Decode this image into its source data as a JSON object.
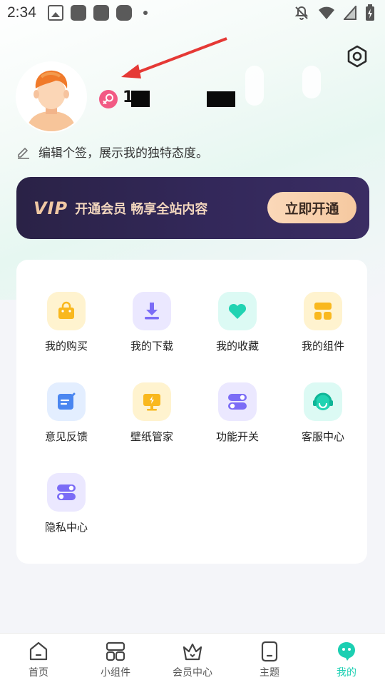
{
  "status_bar": {
    "time": "2:34"
  },
  "profile": {
    "username": "1",
    "bio": "编辑个签，展示我的独特态度。"
  },
  "vip": {
    "logo": "VIP",
    "text": "开通会员 畅享全站内容",
    "button": "立即开通",
    "accent": "#f6c9a0"
  },
  "grid": [
    {
      "label": "我的购买",
      "icon": "shopping-bag-icon",
      "bg": "#fff3cf"
    },
    {
      "label": "我的下载",
      "icon": "download-icon",
      "bg": "#ebe8ff"
    },
    {
      "label": "我的收藏",
      "icon": "heart-icon",
      "bg": "#dcfaf4"
    },
    {
      "label": "我的组件",
      "icon": "widget-icon",
      "bg": "#fff3cf"
    },
    {
      "label": "意见反馈",
      "icon": "feedback-icon",
      "bg": "#e3eeff"
    },
    {
      "label": "壁纸管家",
      "icon": "wallpaper-icon",
      "bg": "#fff3cf"
    },
    {
      "label": "功能开关",
      "icon": "toggle-icon",
      "bg": "#ebe8ff"
    },
    {
      "label": "客服中心",
      "icon": "headset-icon",
      "bg": "#dcfaf4"
    },
    {
      "label": "隐私中心",
      "icon": "privacy-toggle-icon",
      "bg": "#ebe8ff"
    }
  ],
  "bottom_nav": [
    {
      "label": "首页",
      "icon": "home-icon"
    },
    {
      "label": "小组件",
      "icon": "widgets-icon"
    },
    {
      "label": "会员中心",
      "icon": "crown-icon"
    },
    {
      "label": "主题",
      "icon": "theme-icon"
    },
    {
      "label": "我的",
      "icon": "me-icon",
      "active": true
    }
  ],
  "colors": {
    "active": "#1ccfb2",
    "vip_bg": "#2a2246"
  }
}
